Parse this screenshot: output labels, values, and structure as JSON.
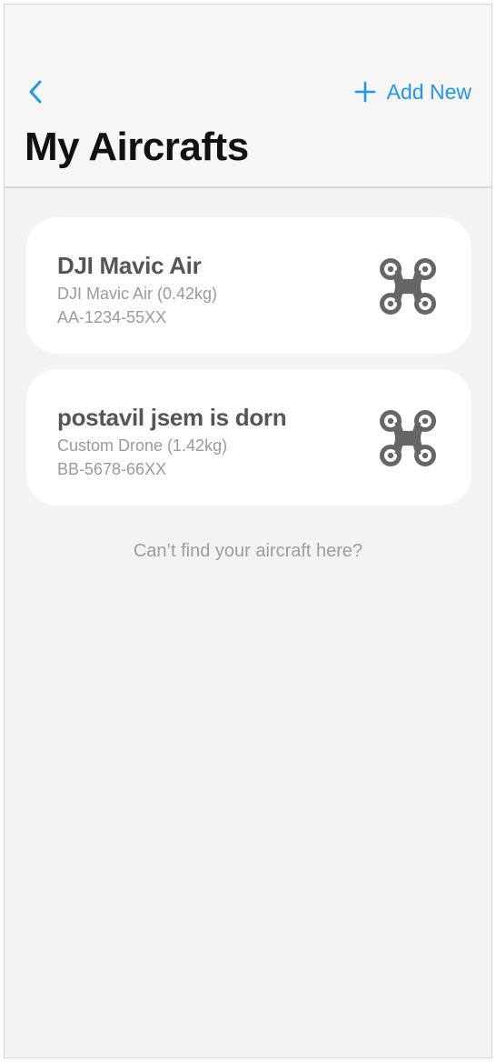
{
  "header": {
    "add_new_label": "Add New",
    "title": "My Aircrafts"
  },
  "aircrafts": [
    {
      "name": "DJI Mavic Air",
      "model": "DJI Mavic Air (0.42kg)",
      "registration": "AA-1234-55XX",
      "icon": "drone-icon"
    },
    {
      "name": "postavil jsem is dorn",
      "model": "Custom Drone (1.42kg)",
      "registration": "BB-5678-66XX",
      "icon": "drone-icon"
    }
  ],
  "footer": {
    "help_link": "Can’t find your aircraft here?"
  },
  "colors": {
    "accent": "#1f97f0",
    "background": "#f3f3f3",
    "card": "#ffffff",
    "icon": "#666666"
  }
}
